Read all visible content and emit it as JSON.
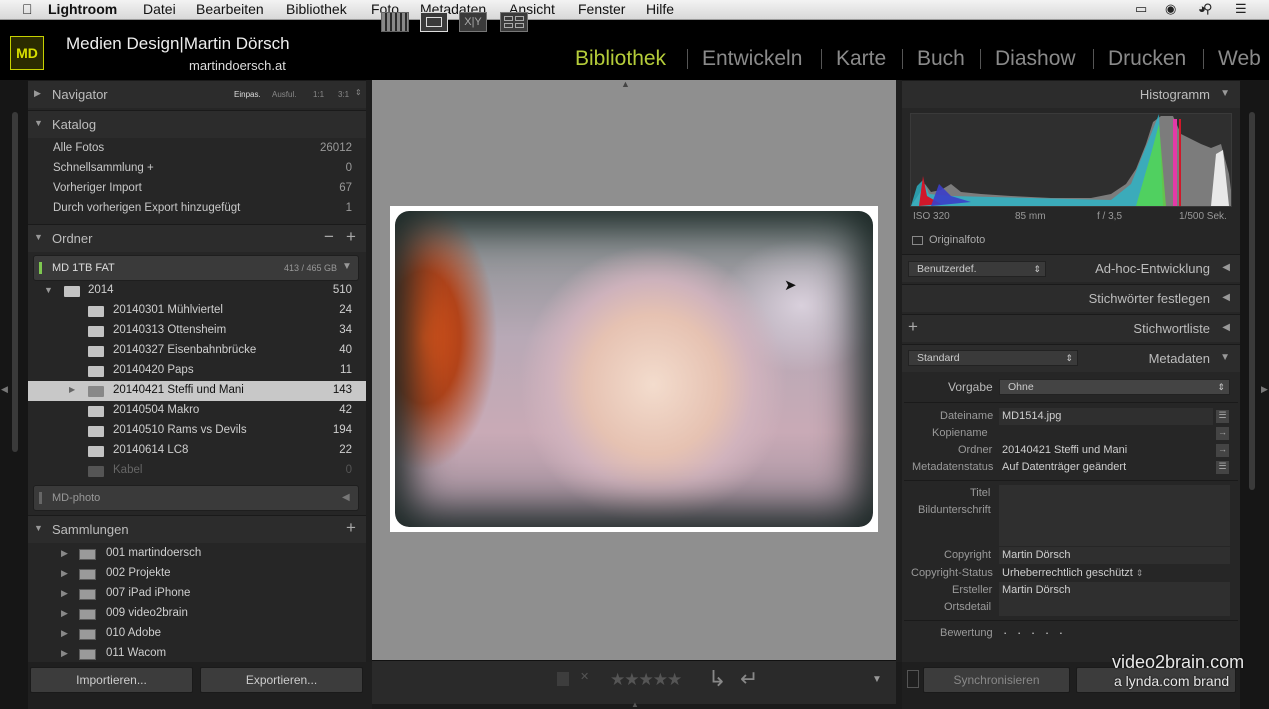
{
  "menubar": {
    "app": "Lightroom",
    "items": [
      "Datei",
      "Bearbeiten",
      "Bibliothek",
      "Foto",
      "Metadaten",
      "Ansicht",
      "Fenster",
      "Hilfe"
    ]
  },
  "identity": {
    "logo": "MD",
    "name": "Medien Design|Martin Dörsch",
    "url": "martindoersch.at"
  },
  "modules": [
    "Bibliothek",
    "Entwickeln",
    "Karte",
    "Buch",
    "Diashow",
    "Drucken",
    "Web"
  ],
  "navigator": {
    "title": "Navigator",
    "zoom": [
      "Einpas.",
      "Ausful.",
      "1:1",
      "3:1"
    ]
  },
  "katalog": {
    "title": "Katalog",
    "items": [
      {
        "label": "Alle Fotos",
        "count": "26012"
      },
      {
        "label": "Schnellsammlung +",
        "count": "0"
      },
      {
        "label": "Vorheriger Import",
        "count": "67"
      },
      {
        "label": "Durch vorherigen Export hinzugefügt",
        "count": "1"
      }
    ]
  },
  "ordner": {
    "title": "Ordner",
    "volume1": {
      "name": "MD 1TB FAT",
      "size": "413 / 465 GB"
    },
    "year": {
      "label": "2014",
      "count": "510"
    },
    "folders": [
      {
        "label": "20140301 Mühlviertel",
        "count": "24"
      },
      {
        "label": "20140313 Ottensheim",
        "count": "34"
      },
      {
        "label": "20140327 Eisenbahnbrücke",
        "count": "40"
      },
      {
        "label": "20140420 Paps",
        "count": "11"
      },
      {
        "label": "20140421 Steffi und Mani",
        "count": "143"
      },
      {
        "label": "20140504 Makro",
        "count": "42"
      },
      {
        "label": "20140510 Rams vs Devils",
        "count": "194"
      },
      {
        "label": "20140614 LC8",
        "count": "22"
      },
      {
        "label": "Kabel",
        "count": "0"
      }
    ],
    "volume2": {
      "name": "MD-photo"
    }
  },
  "sammlungen": {
    "title": "Sammlungen",
    "items": [
      "001 martindoersch",
      "002 Projekte",
      "007 iPad iPhone",
      "009 video2brain",
      "010 Adobe",
      "011 Wacom"
    ]
  },
  "buttons": {
    "import": "Importieren...",
    "export": "Exportieren...",
    "sync": "Synchronisieren"
  },
  "histogram": {
    "title": "Histogramm",
    "iso": "ISO 320",
    "focal": "85 mm",
    "aperture": "f / 3,5",
    "shutter": "1/500 Sek.",
    "original": "Originalfoto"
  },
  "adhoc": {
    "preset": "Benutzerdef.",
    "title": "Ad-hoc-Entwicklung"
  },
  "keywording": {
    "title": "Stichwörter festlegen"
  },
  "keywordlist": {
    "title": "Stichwortliste"
  },
  "metadata": {
    "preset": "Standard",
    "title": "Metadaten",
    "vorgabe_label": "Vorgabe",
    "vorgabe_value": "Ohne",
    "fields": {
      "dateiname": {
        "label": "Dateiname",
        "value": "MD1514.jpg"
      },
      "kopiename": {
        "label": "Kopiename",
        "value": ""
      },
      "ordner": {
        "label": "Ordner",
        "value": "20140421 Steffi und Mani"
      },
      "status": {
        "label": "Metadatenstatus",
        "value": "Auf Datenträger geändert"
      },
      "titel": {
        "label": "Titel",
        "value": ""
      },
      "bildunterschrift": {
        "label": "Bildunterschrift",
        "value": ""
      },
      "copyright": {
        "label": "Copyright",
        "value": "Martin Dörsch"
      },
      "copyrightstatus": {
        "label": "Copyright-Status",
        "value": "Urheberrechtlich geschützt"
      },
      "ersteller": {
        "label": "Ersteller",
        "value": "Martin Dörsch"
      },
      "ortsdetail": {
        "label": "Ortsdetail",
        "value": ""
      },
      "bewertung": {
        "label": "Bewertung",
        "value": "· · · · ·"
      }
    }
  },
  "watermark": {
    "line1": "video2brain.com",
    "line2": "a lynda.com brand"
  }
}
